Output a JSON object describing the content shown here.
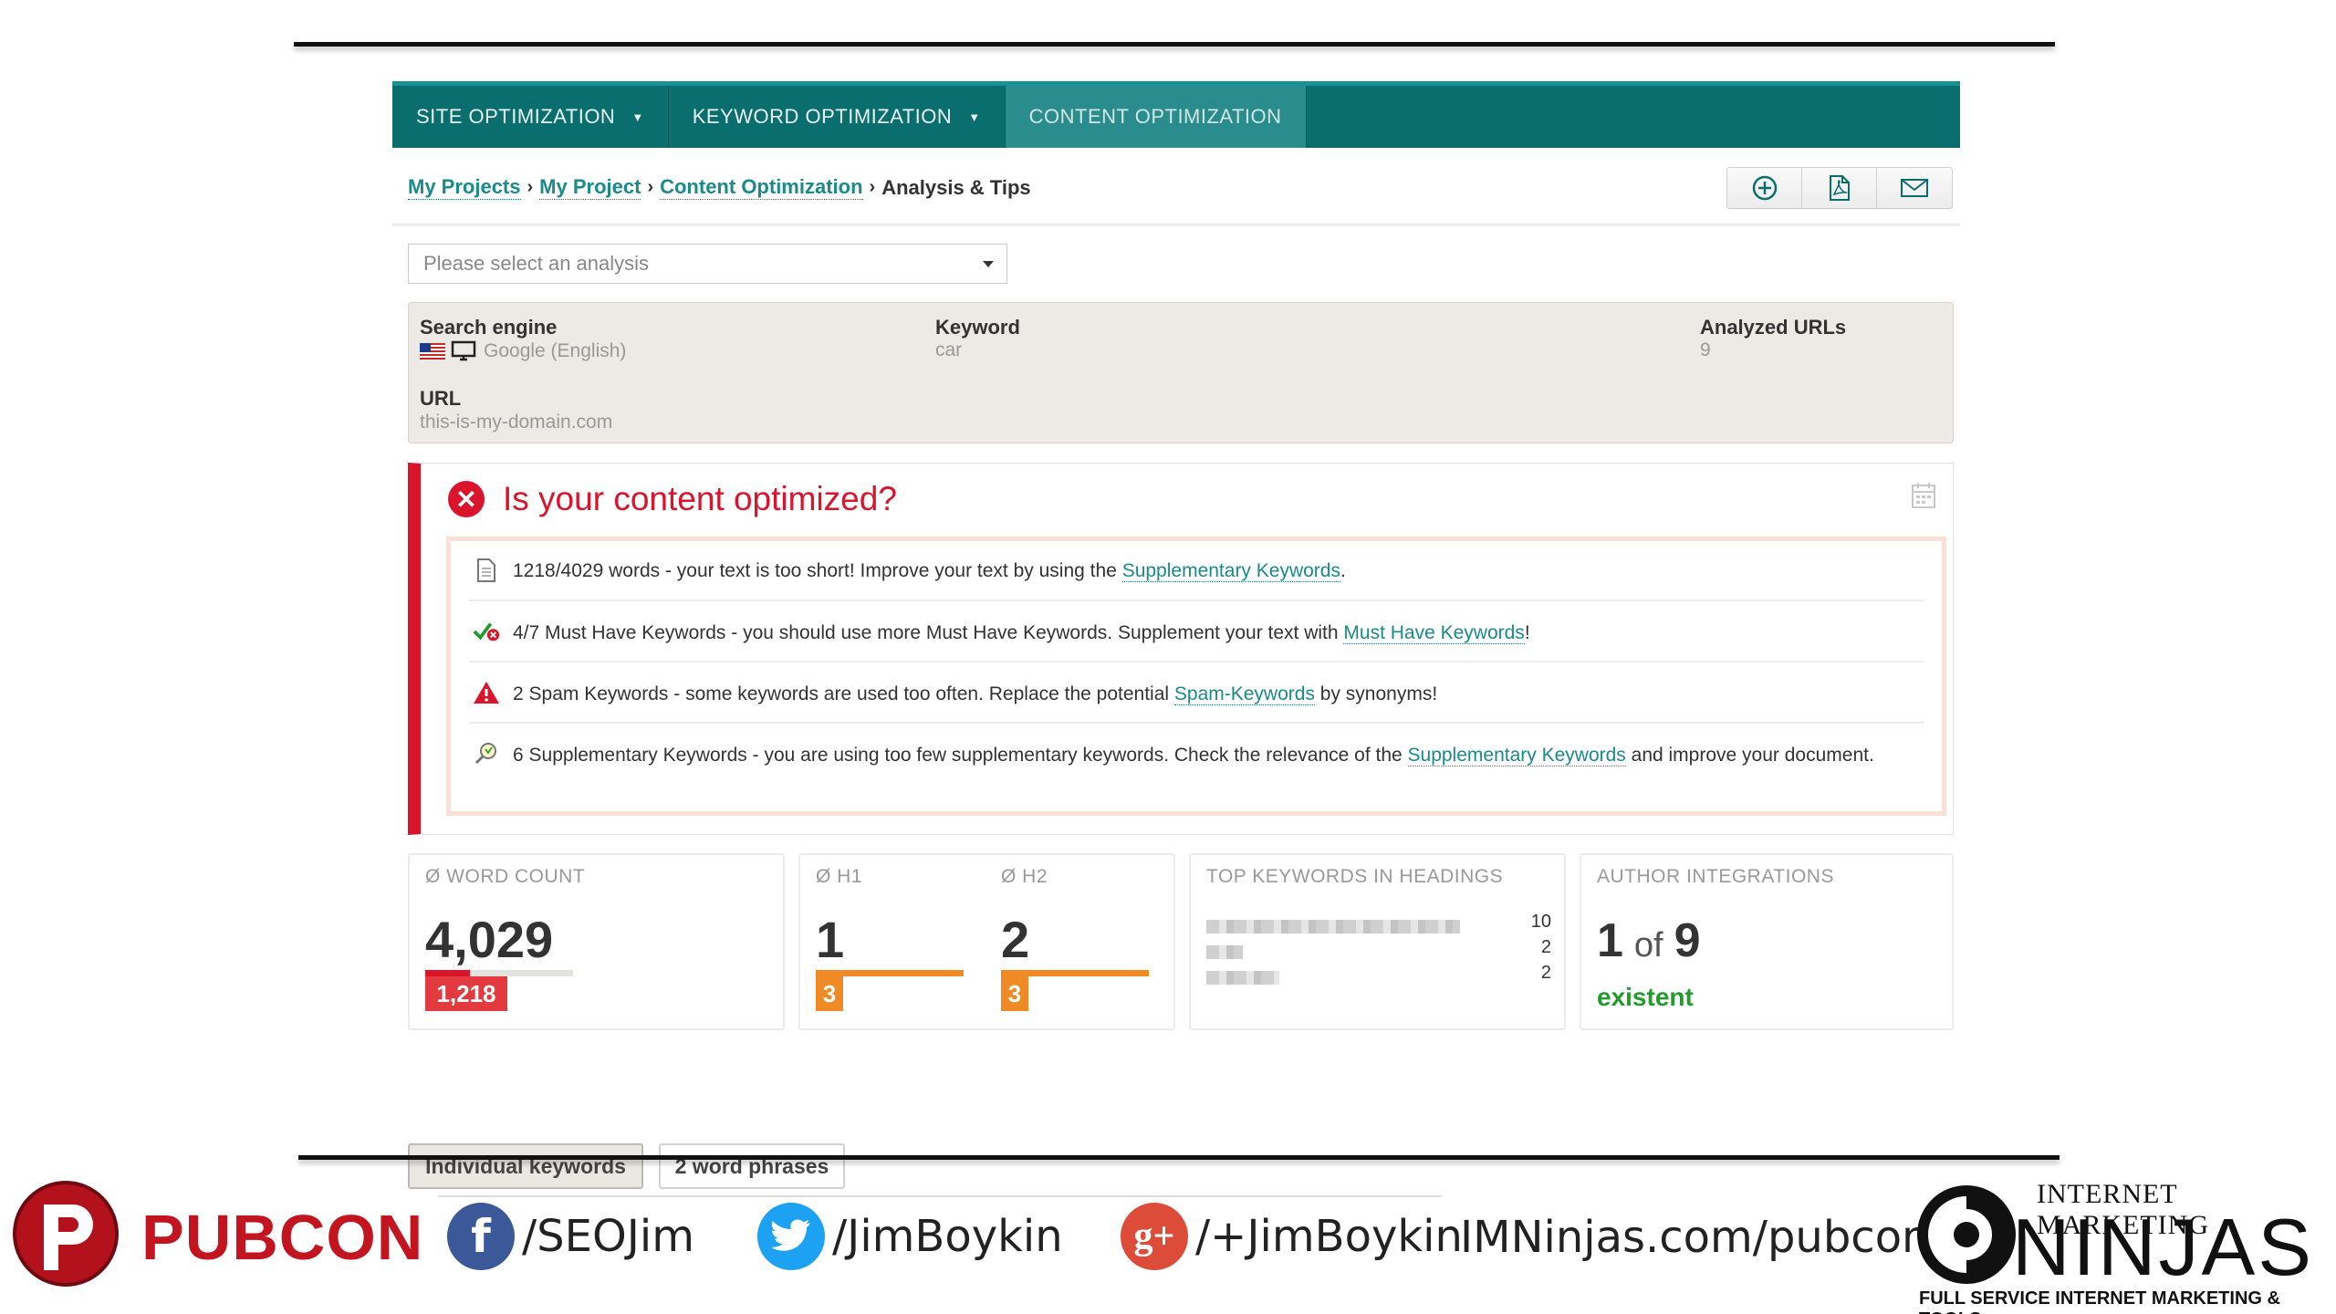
{
  "nav": {
    "items": [
      {
        "label": "SITE OPTIMIZATION",
        "has_menu": true
      },
      {
        "label": "KEYWORD OPTIMIZATION",
        "has_menu": true
      },
      {
        "label": "CONTENT OPTIMIZATION",
        "has_menu": false,
        "active": true
      }
    ]
  },
  "breadcrumb": {
    "items": [
      "My Projects",
      "My Project",
      "Content Optimization"
    ],
    "separator": "›",
    "current": "Analysis & Tips"
  },
  "toolbar": {
    "icons": [
      "add-circle-icon",
      "pdf-icon",
      "email-icon"
    ]
  },
  "analysis_select": {
    "placeholder": "Please select an analysis"
  },
  "info": {
    "search_engine_label": "Search engine",
    "search_engine_value": "Google (English)",
    "keyword_label": "Keyword",
    "keyword_value": "car",
    "analyzed_urls_label": "Analyzed URLs",
    "analyzed_urls_value": "9",
    "url_label": "URL",
    "url_value": "this-is-my-domain.com"
  },
  "alert": {
    "title": "Is your content optimized?",
    "color": "#d9142b",
    "tips": [
      {
        "icon": "document-icon",
        "text": "1218/4029 words - your text is too short! Improve your text by using the ",
        "link": "Supplementary Keywords",
        "after": "."
      },
      {
        "icon": "check-cross-icon",
        "text": "4/7 Must Have Keywords - you should use more Must Have Keywords. Supplement your text with ",
        "link": "Must Have Keywords",
        "after": "!"
      },
      {
        "icon": "warning-icon",
        "text": "2 Spam Keywords - some keywords are used too often. Replace the potential ",
        "link": "Spam-Keywords",
        "after": " by synonyms!"
      },
      {
        "icon": "magnifier-icon",
        "text": "6 Supplementary Keywords - you are using too few supplementary keywords. Check the relevance of the ",
        "link": "Supplementary Keywords",
        "after": " and improve your document."
      }
    ]
  },
  "stats": {
    "word_count": {
      "label": "Ø WORD COUNT",
      "value": "4,029",
      "mine": "1,218",
      "mine_fraction": 0.3
    },
    "h1": {
      "label": "Ø H1",
      "value": "1",
      "mine": "3"
    },
    "h2": {
      "label": "Ø H2",
      "value": "2",
      "mine": "3"
    },
    "top_keywords": {
      "label": "TOP KEYWORDS IN HEADINGS",
      "counts": [
        "10",
        "2",
        "2"
      ]
    },
    "author": {
      "label": "AUTHOR INTEGRATIONS",
      "count": "1",
      "of": "of",
      "total": "9",
      "status": "existent",
      "status_color": "#1f9c2b"
    }
  },
  "buttons": {
    "individual": "Individual keywords",
    "phrases": "2 word phrases"
  },
  "footer": {
    "pubcon": "PUBCON",
    "facebook": "/SEOJim",
    "twitter": "/JimBoykin",
    "gplus": "/+JimBoykin",
    "site": "IMNinjas.com/pubcon",
    "ninjas_top": "INTERNET MARKETING",
    "ninjas_main": "NINJAS",
    "ninjas_bottom": "FULL SERVICE INTERNET MARKETING & TOOLS"
  }
}
